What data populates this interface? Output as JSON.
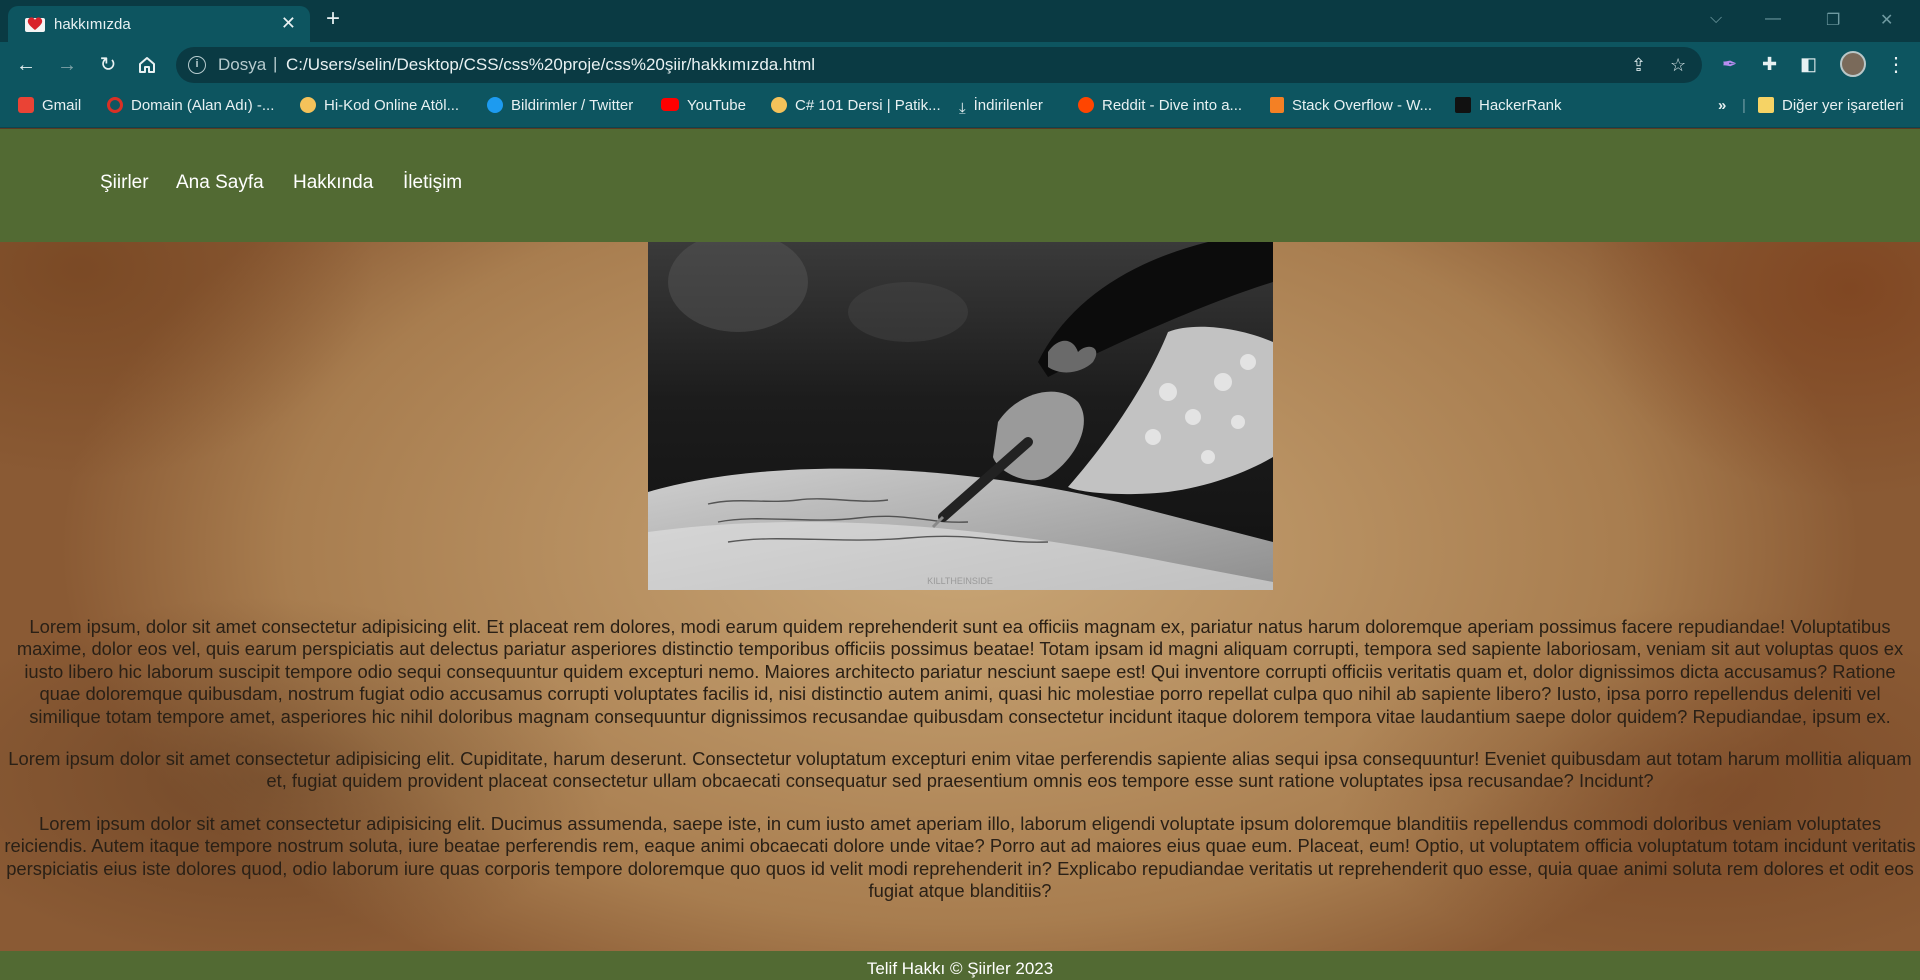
{
  "browser": {
    "tab_title": "hakkımızda",
    "address_scheme": "Dosya",
    "address_url": "C:/Users/selin/Desktop/CSS/css%20proje/css%20şiir/hakkımızda.html",
    "bookmarks": [
      {
        "label": "Gmail",
        "icon": "gmail-icon",
        "color": "#ea4335"
      },
      {
        "label": "Domain (Alan Adı) -...",
        "icon": "domain-icon",
        "color": "#d93025"
      },
      {
        "label": "Hi-Kod Online Atöl...",
        "icon": "hikod-icon",
        "color": "#f4c25a"
      },
      {
        "label": "Bildirimler / Twitter",
        "icon": "twitter-icon",
        "color": "#1d9bf0"
      },
      {
        "label": "YouTube",
        "icon": "youtube-icon",
        "color": "#ff0000"
      },
      {
        "label": "C# 101 Dersi | Patik...",
        "icon": "patika-icon",
        "color": "#f4c25a"
      },
      {
        "label": "İndirilenler",
        "icon": "download-icon",
        "color": "#e8f1f2"
      },
      {
        "label": "Reddit - Dive into a...",
        "icon": "reddit-icon",
        "color": "#ff4500"
      },
      {
        "label": "Stack Overflow - W...",
        "icon": "stackoverflow-icon",
        "color": "#f48024"
      },
      {
        "label": "HackerRank",
        "icon": "hackerrank-icon",
        "color": "#111111"
      }
    ],
    "other_bookmarks": "Diğer yer işaretleri",
    "more_bookmarks": "»"
  },
  "site": {
    "nav": [
      "Şiirler",
      "Ana Sayfa",
      "Hakkında",
      "İletişim"
    ],
    "paragraphs": [
      "Lorem ipsum, dolor sit amet consectetur adipisicing elit. Et placeat rem dolores, modi earum quidem reprehenderit sunt ea officiis magnam ex, pariatur natus harum doloremque aperiam possimus facere repudiandae! Voluptatibus maxime, dolor eos vel, quis earum perspiciatis aut delectus pariatur asperiores distinctio temporibus officiis possimus beatae! Totam ipsam id magni aliquam corrupti, tempora sed sapiente laboriosam, veniam sit aut voluptas quos ex iusto libero hic laborum suscipit tempore odio sequi consequuntur quidem excepturi nemo. Maiores architecto pariatur nesciunt saepe est! Qui inventore corrupti officiis veritatis quam et, dolor dignissimos dicta accusamus? Ratione quae doloremque quibusdam, nostrum fugiat odio accusamus corrupti voluptates facilis id, nisi distinctio autem animi, quasi hic molestiae porro repellat culpa quo nihil ab sapiente libero? Iusto, ipsa porro repellendus deleniti vel similique totam tempore amet, asperiores hic nihil doloribus magnam consequuntur dignissimos recusandae quibusdam consectetur incidunt itaque dolorem tempora vitae laudantium saepe dolor quidem? Repudiandae, ipsum ex.",
      "Lorem ipsum dolor sit amet consectetur adipisicing elit. Cupiditate, harum deserunt. Consectetur voluptatum excepturi enim vitae perferendis sapiente alias sequi ipsa consequuntur! Eveniet quibusdam aut totam harum mollitia aliquam et, fugiat quidem provident placeat consectetur ullam obcaecati consequatur sed praesentium omnis eos tempore esse sunt ratione voluptates ipsa recusandae? Incidunt?",
      "Lorem ipsum dolor sit amet consectetur adipisicing elit. Ducimus assumenda, saepe iste, in cum iusto amet aperiam illo, laborum eligendi voluptate ipsum doloremque blanditiis repellendus commodi doloribus veniam voluptates reiciendis. Autem itaque tempore nostrum soluta, iure beatae perferendis rem, eaque animi obcaecati dolore unde vitae? Porro aut ad maiores eius quae eum. Placeat, eum! Optio, ut voluptatem officia voluptatum totam incidunt veritatis perspiciatis eius iste dolores quod, odio laborum iure quas corporis tempore doloremque quo quos id velit modi reprehenderit in? Explicabo repudiandae veritatis ut reprehenderit quo esse, quia quae animi soluta rem dolores et odit eos fugiat atque blanditiis?"
    ],
    "image_watermark": "KILLTHEINSIDE",
    "footer": "Telif Hakkı © Şiirler 2023",
    "colors": {
      "nav_bg": "#526a33",
      "footer_bg": "#526a33",
      "chrome_tabbar": "#0a3a43",
      "chrome_toolbar": "#0d5560"
    }
  }
}
